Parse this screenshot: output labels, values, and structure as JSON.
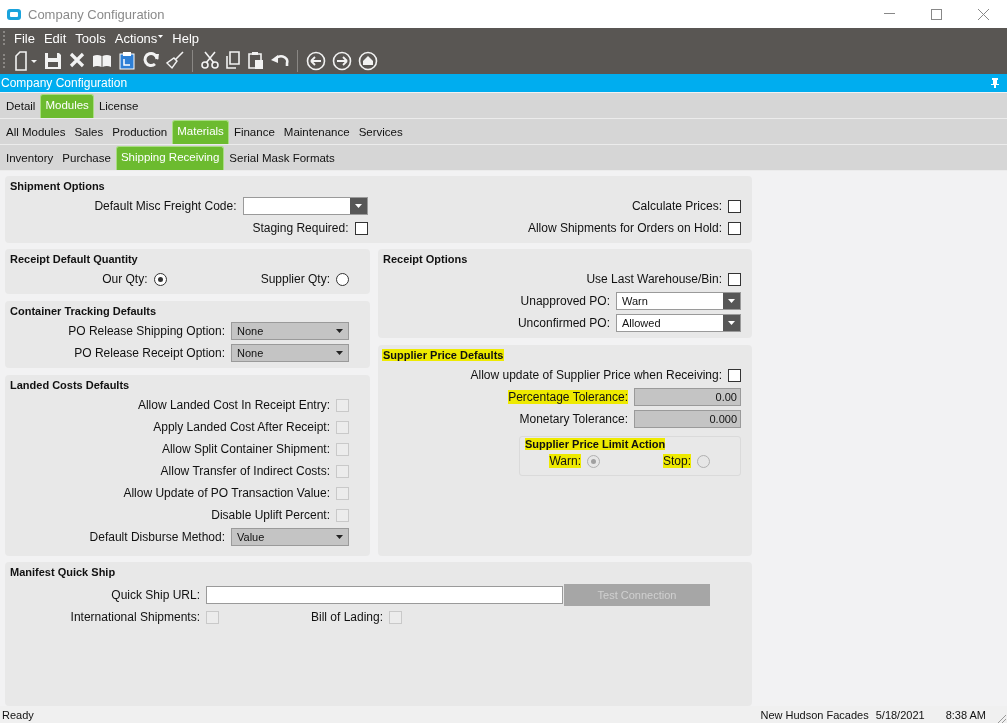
{
  "window": {
    "title": "Company Configuration"
  },
  "menu": [
    {
      "label": "File",
      "dropdown": false
    },
    {
      "label": "Edit",
      "dropdown": false
    },
    {
      "label": "Tools",
      "dropdown": false
    },
    {
      "label": "Actions",
      "dropdown": true
    },
    {
      "label": "Help",
      "dropdown": false
    }
  ],
  "panel_title": "Company Configuration",
  "tab_rows": [
    [
      {
        "label": "Detail",
        "selected": false
      },
      {
        "label": "Modules",
        "selected": true
      },
      {
        "label": "License",
        "selected": false
      }
    ],
    [
      {
        "label": "All Modules",
        "selected": false
      },
      {
        "label": "Sales",
        "selected": false
      },
      {
        "label": "Production",
        "selected": false
      },
      {
        "label": "Materials",
        "selected": true
      },
      {
        "label": "Finance",
        "selected": false
      },
      {
        "label": "Maintenance",
        "selected": false
      },
      {
        "label": "Services",
        "selected": false
      }
    ],
    [
      {
        "label": "Inventory",
        "selected": false
      },
      {
        "label": "Purchase",
        "selected": false
      },
      {
        "label": "Shipping Receiving",
        "selected": true
      },
      {
        "label": "Serial Mask Formats",
        "selected": false
      }
    ]
  ],
  "shipment_options": {
    "title": "Shipment Options",
    "kind": "form",
    "highlighted": false,
    "rows": [
      [
        {
          "kind": "combo",
          "label": "Default Misc Freight Code:",
          "enabled": true,
          "highlighted": false
        },
        {
          "kind": "checkbox",
          "label": "Calculate Prices:",
          "checked": false,
          "enabled": true,
          "highlighted": false
        }
      ],
      [
        {
          "kind": "checkbox",
          "label": "Staging Required:",
          "checked": false,
          "enabled": true,
          "highlighted": false
        },
        {
          "kind": "checkbox",
          "label": "Allow Shipments for Orders on Hold:",
          "checked": false,
          "enabled": true,
          "highlighted": false
        }
      ]
    ]
  },
  "columns": [
    [
      {
        "title": "Receipt Default Quantity",
        "kind": "form",
        "highlighted": false,
        "rows": [
          [
            {
              "kind": "radio",
              "label": "Our Qty:",
              "selected": true,
              "enabled": true,
              "highlighted": false
            },
            {
              "kind": "radio",
              "label": "Supplier Qty:",
              "selected": false,
              "enabled": true,
              "highlighted": false
            }
          ]
        ]
      },
      {
        "title": "Container Tracking Defaults",
        "kind": "form",
        "highlighted": false,
        "rows": [
          [
            {
              "kind": "combo",
              "label": "PO Release Shipping Option:",
              "value": "None",
              "enabled": false,
              "highlighted": false
            }
          ],
          [
            {
              "kind": "combo",
              "label": "PO Release Receipt Option:",
              "value": "None",
              "enabled": false,
              "highlighted": false
            }
          ]
        ]
      },
      {
        "title": "Landed Costs Defaults",
        "kind": "form",
        "highlighted": false,
        "rows": [
          [
            {
              "kind": "checkbox",
              "label": "Allow Landed Cost In Receipt Entry:",
              "checked": false,
              "enabled": false,
              "highlighted": false
            }
          ],
          [
            {
              "kind": "checkbox",
              "label": "Apply Landed Cost After Receipt:",
              "checked": false,
              "enabled": false,
              "highlighted": false
            }
          ],
          [
            {
              "kind": "checkbox",
              "label": "Allow Split Container Shipment:",
              "checked": false,
              "enabled": false,
              "highlighted": false
            }
          ],
          [
            {
              "kind": "checkbox",
              "label": "Allow Transfer of Indirect Costs:",
              "checked": false,
              "enabled": false,
              "highlighted": false
            }
          ],
          [
            {
              "kind": "checkbox",
              "label": "Allow Update of PO Transaction Value:",
              "checked": false,
              "enabled": false,
              "highlighted": false
            }
          ],
          [
            {
              "kind": "checkbox",
              "label": "Disable Uplift Percent:",
              "checked": false,
              "enabled": false,
              "highlighted": false
            }
          ],
          [
            {
              "kind": "combo",
              "label": "Default Disburse Method:",
              "value": "Value",
              "enabled": false,
              "highlighted": false
            }
          ]
        ]
      }
    ],
    [
      {
        "title": "Receipt Options",
        "kind": "form",
        "highlighted": false,
        "rows": [
          [
            {
              "kind": "checkbox",
              "label": "Use Last Warehouse/Bin:",
              "checked": false,
              "enabled": true,
              "highlighted": false
            }
          ],
          [
            {
              "kind": "combo",
              "label": "Unapproved PO:",
              "value": "Warn",
              "enabled": true,
              "highlighted": false
            }
          ],
          [
            {
              "kind": "combo",
              "label": "Unconfirmed PO:",
              "value": "Allowed",
              "enabled": true,
              "highlighted": false
            }
          ]
        ]
      },
      {
        "title": "Supplier Price Defaults",
        "kind": "form",
        "highlighted": true,
        "rows": [
          [
            {
              "kind": "checkbox",
              "label": "Allow update of Supplier Price when Receiving:",
              "checked": false,
              "enabled": true,
              "highlighted": false
            }
          ],
          [
            {
              "kind": "text",
              "label": "Percentage Tolerance:",
              "value": "0.00",
              "enabled": false,
              "highlighted": true
            }
          ],
          [
            {
              "kind": "text",
              "label": "Monetary Tolerance:",
              "value": "0.000",
              "enabled": false,
              "highlighted": false
            }
          ],
          [
            {
              "kind": "group",
              "title": "Supplier Price Limit Action",
              "highlighted": true,
              "rows": [
                [
                  {
                    "kind": "radio",
                    "label": "Warn:",
                    "selected": true,
                    "enabled": false,
                    "highlighted": true
                  },
                  {
                    "kind": "radio",
                    "label": "Stop:",
                    "selected": false,
                    "enabled": false,
                    "highlighted": true
                  }
                ]
              ]
            }
          ]
        ]
      }
    ]
  ],
  "manifest": {
    "title": "Manifest Quick Ship",
    "kind": "flow",
    "highlighted": false,
    "rows": [
      [
        {
          "kind": "text",
          "label": "Quick Ship URL:",
          "enabled": true,
          "highlighted": false
        },
        {
          "kind": "button",
          "label": "Test Connection",
          "enabled": false
        }
      ],
      [
        {
          "kind": "checkbox",
          "label": "International Shipments:",
          "checked": false,
          "enabled": false,
          "highlighted": false
        },
        {
          "kind": "checkbox",
          "label": "Bill of Lading:",
          "checked": false,
          "enabled": false,
          "highlighted": false
        }
      ]
    ]
  },
  "status_bar": {
    "message": "Ready",
    "company": "New Hudson Facades",
    "date": "5/18/2021",
    "time": "8:38 AM"
  }
}
